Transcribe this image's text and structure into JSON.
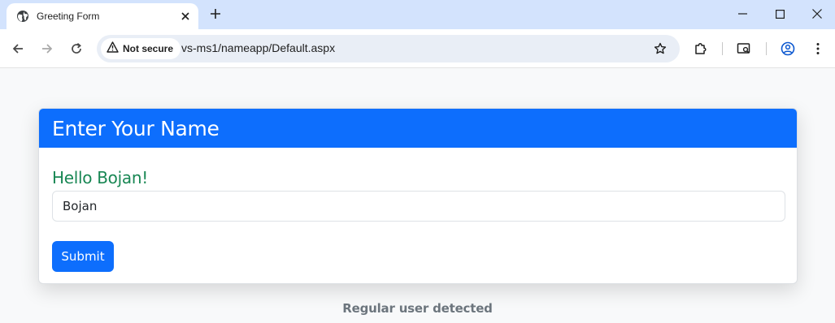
{
  "browser": {
    "tab_title": "Greeting Form",
    "security_label": "Not secure",
    "url": "vs-ms1/nameapp/Default.aspx"
  },
  "icons": {
    "favicon": "globe-icon",
    "close": "close-icon",
    "new_tab": "plus-icon",
    "minimize": "minimize-icon",
    "maximize": "maximize-icon",
    "window_close": "close-icon",
    "back": "back-arrow-icon",
    "forward": "forward-arrow-icon",
    "reload": "reload-icon",
    "warning": "warning-icon",
    "bookmark": "star-icon",
    "extensions": "puzzle-icon",
    "reading_mode": "reading-mode-icon",
    "profile": "profile-icon",
    "menu": "kebab-menu-icon"
  },
  "form": {
    "header_title": "Enter Your Name",
    "greeting": "Hello Bojan!",
    "name_value": "Bojan",
    "submit_label": "Submit"
  },
  "status": {
    "message": "Regular user detected"
  },
  "colors": {
    "header_bg": "#0d6efd",
    "greeting": "#198754",
    "button_bg": "#0d6efd",
    "status_text": "#6c757d",
    "tabstrip_bg": "#d3e3fd"
  }
}
